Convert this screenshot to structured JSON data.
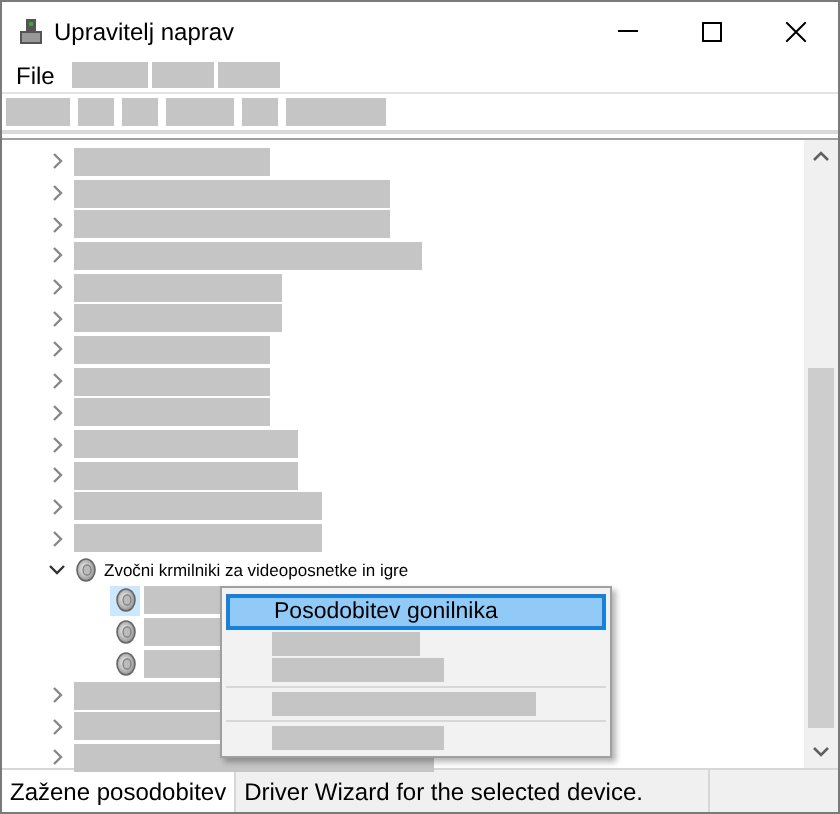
{
  "window": {
    "title": "Upravitelj naprav"
  },
  "menu_bar": [
    "File"
  ],
  "tree": [
    {
      "expanded": false
    },
    {
      "expanded": false
    },
    {
      "expanded": false
    },
    {
      "expanded": false
    },
    {
      "expanded": false
    },
    {
      "expanded": false
    },
    {
      "expanded": false
    },
    {
      "expanded": false
    },
    {
      "expanded": false
    },
    {
      "expanded": false
    },
    {
      "expanded": false
    },
    {
      "expanded": false
    },
    {
      "expanded": false
    },
    {
      "label": "Zvočni krmilniki za videoposnetke in igre",
      "expanded": true,
      "children": [
        {
          "selected": true
        },
        {
          "selected": false
        },
        {
          "selected": false
        }
      ]
    },
    {
      "expanded": false
    },
    {
      "expanded": false
    },
    {
      "expanded": false
    }
  ],
  "context_menu": [
    {
      "kind": "item",
      "label": "Posodobitev gonilnika",
      "selected": true
    },
    {
      "kind": "redacted"
    },
    {
      "kind": "redacted"
    },
    {
      "kind": "separator"
    },
    {
      "kind": "redacted"
    },
    {
      "kind": "separator"
    },
    {
      "kind": "redacted"
    }
  ],
  "status_bar": [
    "Zažene posodobitev",
    "Driver Wizard for the selected device."
  ]
}
